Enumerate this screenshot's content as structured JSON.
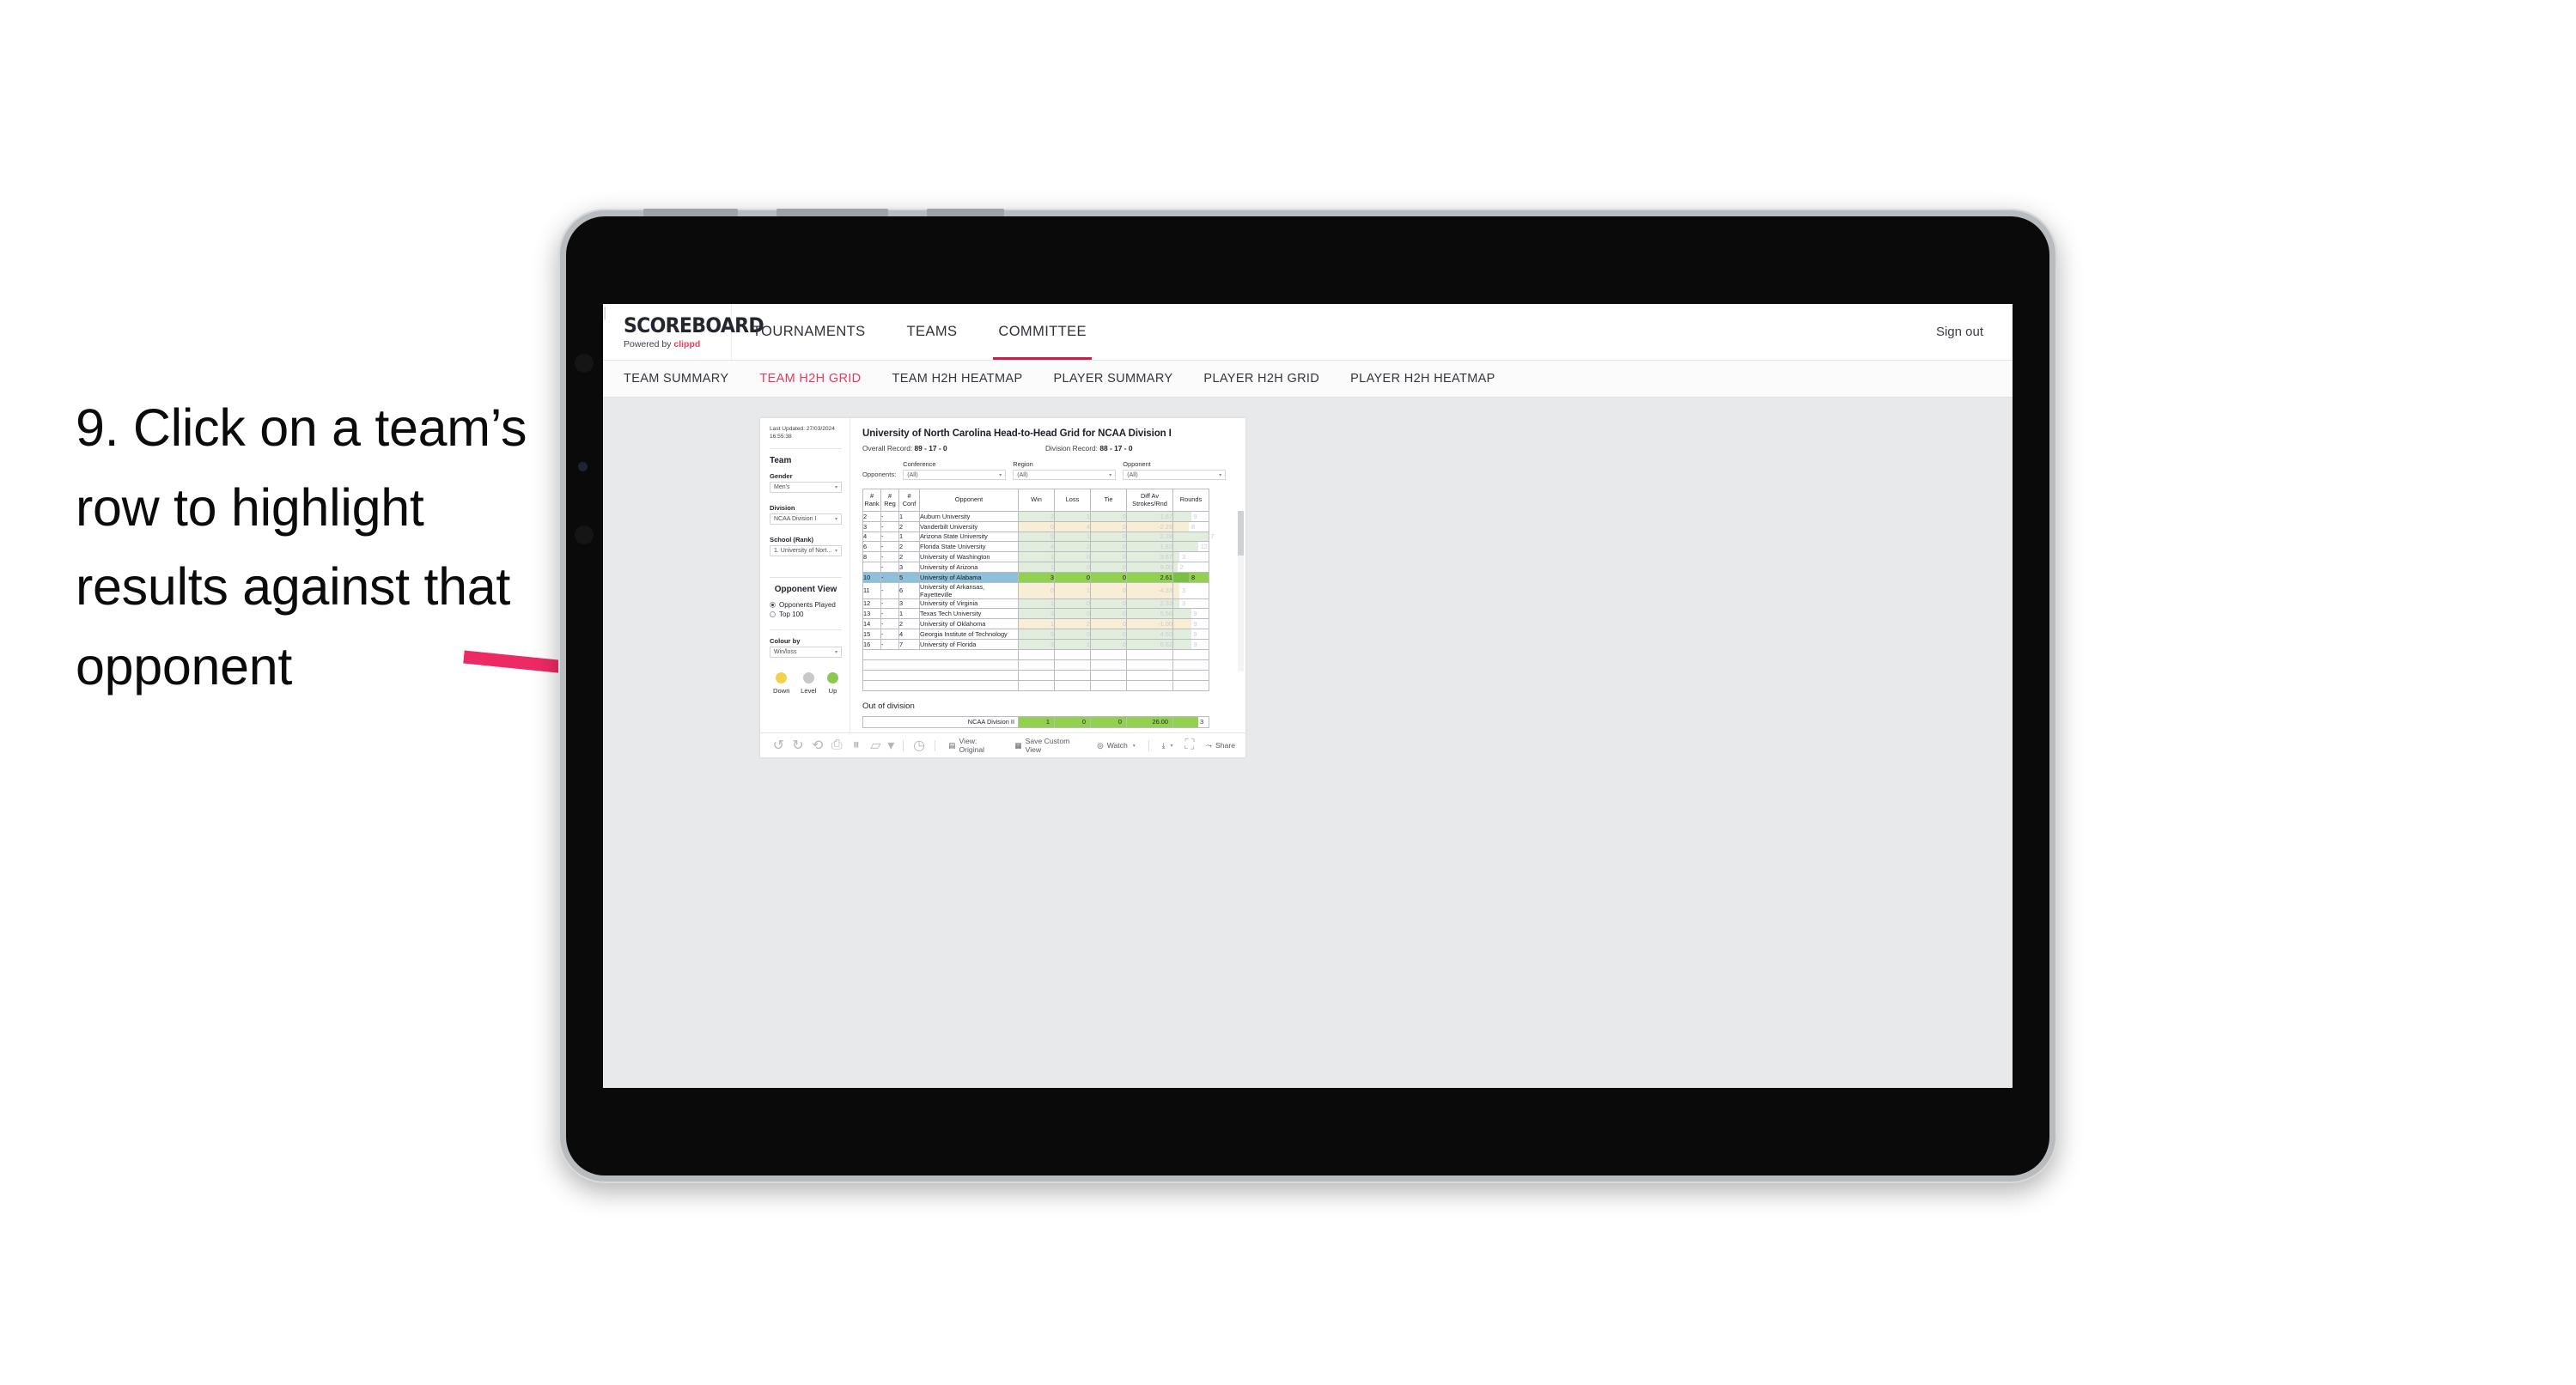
{
  "caption": "9. Click on a team’s row to highlight results against that opponent",
  "brand": {
    "wordmark": "SCOREBOARD",
    "powered_prefix": "Powered by ",
    "powered_brand": "clippd"
  },
  "topnav": {
    "items": [
      "TOURNAMENTS",
      "TEAMS",
      "COMMITTEE"
    ],
    "active": "COMMITTEE",
    "sign_out": "Sign out",
    "divider": "|"
  },
  "subnav": {
    "items": [
      "TEAM SUMMARY",
      "TEAM H2H GRID",
      "TEAM H2H HEATMAP",
      "PLAYER SUMMARY",
      "PLAYER H2H GRID",
      "PLAYER H2H HEATMAP"
    ],
    "active": "TEAM H2H GRID"
  },
  "pane": {
    "last_updated": "Last Updated: 27/03/2024 16:55:38",
    "team_heading": "Team",
    "gender_label": "Gender",
    "gender_value": "Men’s",
    "division_label": "Division",
    "division_value": "NCAA Division I",
    "school_label": "School (Rank)",
    "school_value": "1. University of Nort...",
    "opponent_view_heading": "Opponent View",
    "opponent_view_options": [
      "Opponents Played",
      "Top 100"
    ],
    "opponent_view_selected": "Opponents Played",
    "colour_by_label": "Colour by",
    "colour_by_value": "Win/loss",
    "legend": [
      {
        "label": "Down",
        "color": "#f5d council"
      },
      {
        "label": "Level",
        "color": "#c6c8ca"
      },
      {
        "label": "Up",
        "color": "#8cc751"
      }
    ]
  },
  "viz": {
    "title": "University of North Carolina Head-to-Head Grid for NCAA Division I",
    "overall_record_label": "Overall Record: ",
    "overall_record_value": "89 - 17 - 0",
    "division_record_label": "Division Record: ",
    "division_record_value": "88 - 17 - 0",
    "opponents_label": "Opponents:",
    "filters": [
      {
        "label": "Conference",
        "value": "(All)"
      },
      {
        "label": "Region",
        "value": "(All)"
      },
      {
        "label": "Opponent",
        "value": "(All)"
      }
    ]
  },
  "chart_data": {
    "type": "table",
    "title": "University of North Carolina Head-to-Head Grid for NCAA Division I",
    "columns": [
      "# Rank",
      "# Reg",
      "# Conf",
      "Opponent",
      "Win",
      "Loss",
      "Tie",
      "Diff Av Strokes/Rnd",
      "Rounds"
    ],
    "header_lines": [
      [
        "#",
        "Rank"
      ],
      [
        "#",
        "Reg"
      ],
      [
        "#",
        "Conf"
      ],
      [
        "Opponent",
        ""
      ],
      [
        "Win",
        ""
      ],
      [
        "Loss",
        ""
      ],
      [
        "Tie",
        ""
      ],
      [
        "Diff Av",
        "Strokes/Rnd"
      ],
      [
        "Rounds",
        ""
      ]
    ],
    "rows": [
      {
        "rank": "2",
        "reg": "-",
        "conf": "1",
        "opponent": "Auburn University",
        "win": "2",
        "loss": "1",
        "tie": "0",
        "diff": "1.67",
        "rounds": "9",
        "tone": "up",
        "selected": false,
        "bar_pct": 50
      },
      {
        "rank": "3",
        "reg": "-",
        "conf": "2",
        "opponent": "Vanderbilt University",
        "win": "0",
        "loss": "4",
        "tie": "0",
        "diff": "-2.29",
        "rounds": "8",
        "tone": "down",
        "selected": false,
        "bar_pct": 44
      },
      {
        "rank": "4",
        "reg": "-",
        "conf": "1",
        "opponent": "Arizona State University",
        "win": "5",
        "loss": "1",
        "tie": "0",
        "diff": "2.28",
        "rounds": "17",
        "tone": "up",
        "selected": false,
        "bar_pct": 100
      },
      {
        "rank": "6",
        "reg": "-",
        "conf": "2",
        "opponent": "Florida State University",
        "win": "4",
        "loss": "2",
        "tie": "0",
        "diff": "1.83",
        "rounds": "12",
        "tone": "up",
        "selected": false,
        "bar_pct": 70
      },
      {
        "rank": "8",
        "reg": "-",
        "conf": "2",
        "opponent": "University of Washington",
        "win": "1",
        "loss": "0",
        "tie": "0",
        "diff": "3.67",
        "rounds": "3",
        "tone": "up",
        "selected": false,
        "bar_pct": 17
      },
      {
        "rank": "",
        "reg": "-",
        "conf": "3",
        "opponent": "University of Arizona",
        "win": "1",
        "loss": "0",
        "tie": "0",
        "diff": "9.00",
        "rounds": "2",
        "tone": "up",
        "selected": false,
        "bar_pct": 11
      },
      {
        "rank": "10",
        "reg": "-",
        "conf": "5",
        "opponent": "University of Alabama",
        "win": "3",
        "loss": "0",
        "tie": "0",
        "diff": "2.61",
        "rounds": "8",
        "tone": "up",
        "selected": true,
        "bar_pct": 44
      },
      {
        "rank": "11",
        "reg": "-",
        "conf": "6",
        "opponent": "University of Arkansas, Fayetteville",
        "win": "0",
        "loss": "1",
        "tie": "0",
        "diff": "-4.33",
        "rounds": "3",
        "tone": "down",
        "selected": false,
        "bar_pct": 17
      },
      {
        "rank": "12",
        "reg": "-",
        "conf": "3",
        "opponent": "University of Virginia",
        "win": "1",
        "loss": "0",
        "tie": "0",
        "diff": "2.33",
        "rounds": "3",
        "tone": "up",
        "selected": false,
        "bar_pct": 17
      },
      {
        "rank": "13",
        "reg": "-",
        "conf": "1",
        "opponent": "Texas Tech University",
        "win": "3",
        "loss": "0",
        "tie": "0",
        "diff": "5.56",
        "rounds": "9",
        "tone": "up",
        "selected": false,
        "bar_pct": 50
      },
      {
        "rank": "14",
        "reg": "-",
        "conf": "2",
        "opponent": "University of Oklahoma",
        "win": "1",
        "loss": "2",
        "tie": "0",
        "diff": "-1.00",
        "rounds": "9",
        "tone": "down",
        "selected": false,
        "bar_pct": 50
      },
      {
        "rank": "15",
        "reg": "-",
        "conf": "4",
        "opponent": "Georgia Institute of Technology",
        "win": "5",
        "loss": "0",
        "tie": "0",
        "diff": "4.50",
        "rounds": "9",
        "tone": "up",
        "selected": false,
        "bar_pct": 50
      },
      {
        "rank": "16",
        "reg": "-",
        "conf": "7",
        "opponent": "University of Florida",
        "win": "3",
        "loss": "1",
        "tie": "0",
        "diff": "6.62",
        "rounds": "9",
        "tone": "up",
        "selected": false,
        "bar_pct": 50
      }
    ],
    "out_of_division": {
      "heading": "Out of division",
      "label": "NCAA Division II",
      "win": "1",
      "loss": "0",
      "tie": "0",
      "diff": "26.00",
      "rounds": "3"
    }
  },
  "toolbar": {
    "view_label": "View: Original",
    "save_label": "Save Custom View",
    "watch_label": "Watch",
    "share_label": "Share"
  },
  "colors": {
    "accent_pink": "#e8395f",
    "brand_red": "#c62048",
    "arrow": "#ee2a64",
    "highlight_blue": "#8fc0da",
    "highlight_green": "#92d050",
    "tone_up": "#e2eedd",
    "tone_down": "#f8eed6",
    "legend_down": "#f2d24b",
    "legend_level": "#c6c8ca",
    "legend_up": "#8cc751"
  }
}
